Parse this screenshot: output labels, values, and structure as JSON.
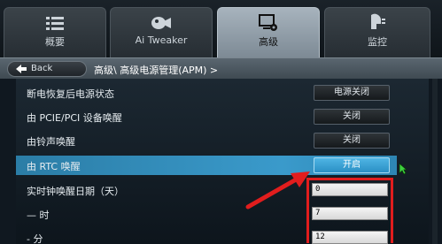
{
  "tabs": [
    {
      "label": "概要",
      "icon": "list-icon"
    },
    {
      "label": "Ai Tweaker",
      "icon": "tweaker-icon"
    },
    {
      "label": "高级",
      "icon": "advanced-icon"
    },
    {
      "label": "监控",
      "icon": "monitor-icon"
    }
  ],
  "breadcrumb": {
    "back_label": "Back",
    "path": "高级\\ 高级电源管理(APM) >"
  },
  "settings": [
    {
      "label": "断电恢复后电源状态",
      "value": "电源关闭",
      "control": "button"
    },
    {
      "label": "由 PCIE/PCI 设备唤醒",
      "value": "关闭",
      "control": "button"
    },
    {
      "label": "由铃声唤醒",
      "value": "关闭",
      "control": "button"
    },
    {
      "label": "由 RTC 唤醒",
      "value": "开启",
      "control": "button",
      "highlighted": true
    },
    {
      "label": "实时钟唤醒日期（天）",
      "value": "0",
      "control": "input"
    },
    {
      "label": "— 时",
      "value": "7",
      "control": "input"
    },
    {
      "label": "- 分",
      "value": "12",
      "control": "input"
    }
  ],
  "colors": {
    "highlight": "#3a9acb",
    "annotation": "#e11d1d"
  }
}
